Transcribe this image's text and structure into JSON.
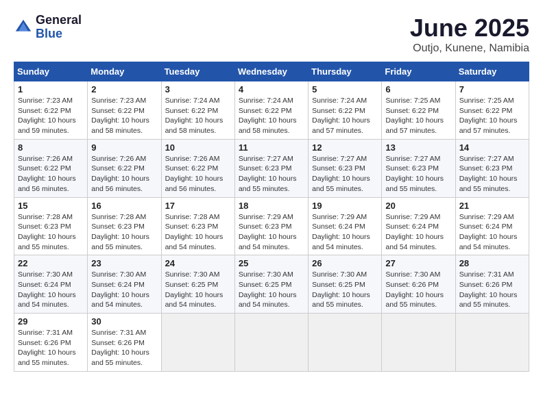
{
  "header": {
    "logo_general": "General",
    "logo_blue": "Blue",
    "title": "June 2025",
    "location": "Outjo, Kunene, Namibia"
  },
  "calendar": {
    "days_of_week": [
      "Sunday",
      "Monday",
      "Tuesday",
      "Wednesday",
      "Thursday",
      "Friday",
      "Saturday"
    ],
    "weeks": [
      [
        null,
        {
          "day": 2,
          "sunrise": "7:23 AM",
          "sunset": "6:22 PM",
          "daylight": "10 hours and 58 minutes."
        },
        {
          "day": 3,
          "sunrise": "7:24 AM",
          "sunset": "6:22 PM",
          "daylight": "10 hours and 58 minutes."
        },
        {
          "day": 4,
          "sunrise": "7:24 AM",
          "sunset": "6:22 PM",
          "daylight": "10 hours and 58 minutes."
        },
        {
          "day": 5,
          "sunrise": "7:24 AM",
          "sunset": "6:22 PM",
          "daylight": "10 hours and 57 minutes."
        },
        {
          "day": 6,
          "sunrise": "7:25 AM",
          "sunset": "6:22 PM",
          "daylight": "10 hours and 57 minutes."
        },
        {
          "day": 7,
          "sunrise": "7:25 AM",
          "sunset": "6:22 PM",
          "daylight": "10 hours and 57 minutes."
        }
      ],
      [
        {
          "day": 1,
          "sunrise": "7:23 AM",
          "sunset": "6:22 PM",
          "daylight": "10 hours and 59 minutes."
        },
        null,
        null,
        null,
        null,
        null,
        null
      ],
      [
        {
          "day": 8,
          "sunrise": "7:26 AM",
          "sunset": "6:22 PM",
          "daylight": "10 hours and 56 minutes."
        },
        {
          "day": 9,
          "sunrise": "7:26 AM",
          "sunset": "6:22 PM",
          "daylight": "10 hours and 56 minutes."
        },
        {
          "day": 10,
          "sunrise": "7:26 AM",
          "sunset": "6:22 PM",
          "daylight": "10 hours and 56 minutes."
        },
        {
          "day": 11,
          "sunrise": "7:27 AM",
          "sunset": "6:23 PM",
          "daylight": "10 hours and 55 minutes."
        },
        {
          "day": 12,
          "sunrise": "7:27 AM",
          "sunset": "6:23 PM",
          "daylight": "10 hours and 55 minutes."
        },
        {
          "day": 13,
          "sunrise": "7:27 AM",
          "sunset": "6:23 PM",
          "daylight": "10 hours and 55 minutes."
        },
        {
          "day": 14,
          "sunrise": "7:27 AM",
          "sunset": "6:23 PM",
          "daylight": "10 hours and 55 minutes."
        }
      ],
      [
        {
          "day": 15,
          "sunrise": "7:28 AM",
          "sunset": "6:23 PM",
          "daylight": "10 hours and 55 minutes."
        },
        {
          "day": 16,
          "sunrise": "7:28 AM",
          "sunset": "6:23 PM",
          "daylight": "10 hours and 55 minutes."
        },
        {
          "day": 17,
          "sunrise": "7:28 AM",
          "sunset": "6:23 PM",
          "daylight": "10 hours and 54 minutes."
        },
        {
          "day": 18,
          "sunrise": "7:29 AM",
          "sunset": "6:23 PM",
          "daylight": "10 hours and 54 minutes."
        },
        {
          "day": 19,
          "sunrise": "7:29 AM",
          "sunset": "6:24 PM",
          "daylight": "10 hours and 54 minutes."
        },
        {
          "day": 20,
          "sunrise": "7:29 AM",
          "sunset": "6:24 PM",
          "daylight": "10 hours and 54 minutes."
        },
        {
          "day": 21,
          "sunrise": "7:29 AM",
          "sunset": "6:24 PM",
          "daylight": "10 hours and 54 minutes."
        }
      ],
      [
        {
          "day": 22,
          "sunrise": "7:30 AM",
          "sunset": "6:24 PM",
          "daylight": "10 hours and 54 minutes."
        },
        {
          "day": 23,
          "sunrise": "7:30 AM",
          "sunset": "6:24 PM",
          "daylight": "10 hours and 54 minutes."
        },
        {
          "day": 24,
          "sunrise": "7:30 AM",
          "sunset": "6:25 PM",
          "daylight": "10 hours and 54 minutes."
        },
        {
          "day": 25,
          "sunrise": "7:30 AM",
          "sunset": "6:25 PM",
          "daylight": "10 hours and 54 minutes."
        },
        {
          "day": 26,
          "sunrise": "7:30 AM",
          "sunset": "6:25 PM",
          "daylight": "10 hours and 55 minutes."
        },
        {
          "day": 27,
          "sunrise": "7:30 AM",
          "sunset": "6:26 PM",
          "daylight": "10 hours and 55 minutes."
        },
        {
          "day": 28,
          "sunrise": "7:31 AM",
          "sunset": "6:26 PM",
          "daylight": "10 hours and 55 minutes."
        }
      ],
      [
        {
          "day": 29,
          "sunrise": "7:31 AM",
          "sunset": "6:26 PM",
          "daylight": "10 hours and 55 minutes."
        },
        {
          "day": 30,
          "sunrise": "7:31 AM",
          "sunset": "6:26 PM",
          "daylight": "10 hours and 55 minutes."
        },
        null,
        null,
        null,
        null,
        null
      ]
    ]
  }
}
